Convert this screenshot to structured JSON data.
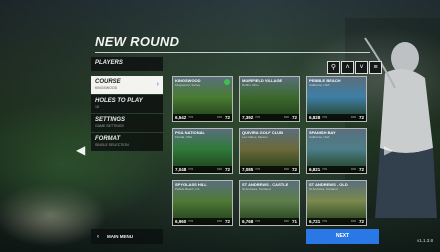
{
  "screen": {
    "title": "NEW ROUND",
    "version": "v1.1.3.8"
  },
  "menu": [
    {
      "label": "PLAYERS",
      "sub": ""
    },
    {
      "label": "COURSE",
      "sub": "KINGSWOOD"
    },
    {
      "label": "HOLES TO PLAY",
      "sub": "18"
    },
    {
      "label": "SETTINGS",
      "sub": "GAME SETTINGS"
    },
    {
      "label": "FORMAT",
      "sub": "SINGLE SELECTION"
    }
  ],
  "toolbar": {
    "search_icon": "search-icon",
    "sort_up_icon": "chevron-up-icon",
    "sort_down_icon": "chevron-down-icon",
    "list_icon": "list-icon"
  },
  "courses": [
    {
      "name": "KINGSWOOD",
      "location": "Kingswood, Surrey",
      "yards": "6,542",
      "yards_unit": "YDS",
      "par": "72",
      "par_unit": "PAR",
      "selected": true,
      "palette": "#4a7d32"
    },
    {
      "name": "MUIRFIELD VILLAGE",
      "location": "Dublin, Ohio",
      "yards": "7,392",
      "yards_unit": "YDS",
      "par": "72",
      "par_unit": "PAR",
      "selected": false,
      "palette": "#3c6a2c"
    },
    {
      "name": "PEBBLE BEACH",
      "location": "California, USA",
      "yards": "6,828",
      "yards_unit": "YDS",
      "par": "72",
      "par_unit": "PAR",
      "selected": false,
      "palette": "#3f7fa6"
    },
    {
      "name": "PGA NATIONAL",
      "location": "Florida, USA",
      "yards": "7,048",
      "yards_unit": "YDS",
      "par": "72",
      "par_unit": "PAR",
      "selected": false,
      "palette": "#2f7a3a"
    },
    {
      "name": "QUIVIRA GOLF CLUB",
      "location": "Los Cabos, Mexico",
      "yards": "7,085",
      "yards_unit": "YDS",
      "par": "72",
      "par_unit": "PAR",
      "selected": false,
      "palette": "#6b6a3a"
    },
    {
      "name": "SPANISH BAY",
      "location": "California, USA",
      "yards": "6,821",
      "yards_unit": "YDS",
      "par": "72",
      "par_unit": "PAR",
      "selected": false,
      "palette": "#4d7f8a"
    },
    {
      "name": "SPYGLASS HILL",
      "location": "Pebble Beach, CA",
      "yards": "6,960",
      "yards_unit": "YDS",
      "par": "72",
      "par_unit": "PAR",
      "selected": false,
      "palette": "#4f7a36"
    },
    {
      "name": "ST ANDREWS - CASTLE",
      "location": "St Andrews, Scotland",
      "yards": "6,768",
      "yards_unit": "YDS",
      "par": "71",
      "par_unit": "PAR",
      "selected": false,
      "palette": "#5d7f4a"
    },
    {
      "name": "ST ANDREWS - OLD",
      "location": "St Andrews, Scotland",
      "yards": "6,721",
      "yards_unit": "YDS",
      "par": "72",
      "par_unit": "PAR",
      "selected": false,
      "palette": "#7a8a4e"
    }
  ],
  "footer": {
    "main_menu": "MAIN MENU",
    "next": "NEXT"
  }
}
